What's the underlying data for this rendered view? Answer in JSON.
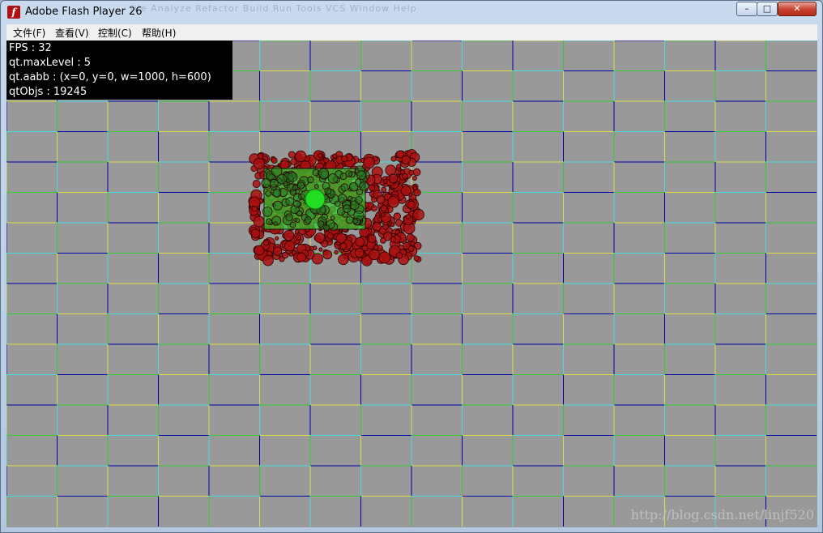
{
  "window": {
    "title": "Adobe Flash Player 26",
    "ghost_menu": "file   Analyze   Refactor   Build   Run   Tools   VCS   Window   Help",
    "buttons": {
      "minimize": "–",
      "maximize": "□",
      "close": "✕"
    }
  },
  "menu": [
    {
      "label": "文件(F)"
    },
    {
      "label": "查看(V)"
    },
    {
      "label": "控制(C)"
    },
    {
      "label": "帮助(H)"
    }
  ],
  "hud": {
    "fps": "FPS : 32",
    "max_level": "qt.maxLevel : 5",
    "aabb": "qt.aabb : (x=0, y=0, w=1000, h=600)",
    "objs": "qtObjs : 19245"
  },
  "watermark": "http://blog.csdn.net/linjf520",
  "colors": {
    "stage": "#999999",
    "grid": [
      "#0000aa",
      "#33cc33",
      "#dddd44",
      "#44dddd"
    ],
    "query_rect": "#33cc33",
    "particles": "#aa1111"
  }
}
